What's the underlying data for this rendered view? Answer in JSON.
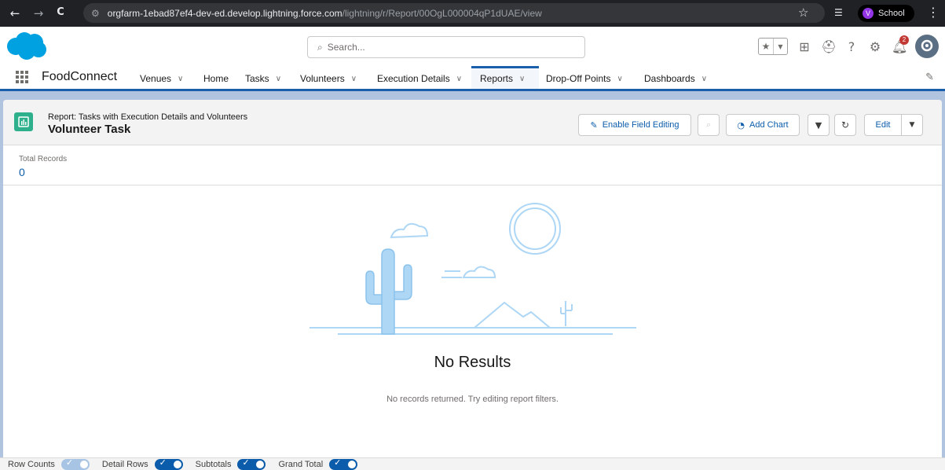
{
  "browser": {
    "back": "←",
    "forward": "→",
    "reload": "C",
    "url_host": "orgfarm-1ebad87ef4-dev-ed.develop.lightning.force.com",
    "url_path": "/lightning/r/Report/00OgL000004qP1dUAE/view",
    "profile_initial": "V",
    "profile_name": "School",
    "menu": "⋮"
  },
  "header": {
    "search_placeholder": "Search...",
    "notification_count": "2"
  },
  "nav": {
    "app_name": "FoodConnect",
    "items": [
      {
        "label": "Venues",
        "has_menu": true
      },
      {
        "label": "Home",
        "has_menu": false
      },
      {
        "label": "Tasks",
        "has_menu": true
      },
      {
        "label": "Volunteers",
        "has_menu": true
      },
      {
        "label": "Execution Details",
        "has_menu": true
      },
      {
        "label": "Reports",
        "has_menu": true,
        "active": true
      },
      {
        "label": "Drop-Off Points",
        "has_menu": true
      },
      {
        "label": "Dashboards",
        "has_menu": true
      }
    ]
  },
  "report": {
    "kicker": "Report: Tasks with Execution Details and Volunteers",
    "title": "Volunteer Task",
    "buttons": {
      "enable_field_editing": "Enable Field Editing",
      "add_chart": "Add Chart",
      "edit": "Edit"
    },
    "total_records_label": "Total Records",
    "total_records_value": "0",
    "empty_title": "No Results",
    "empty_message": "No records returned. Try editing report filters."
  },
  "footer": {
    "toggles": [
      {
        "label": "Row Counts",
        "on": false
      },
      {
        "label": "Detail Rows",
        "on": true
      },
      {
        "label": "Subtotals",
        "on": true
      },
      {
        "label": "Grand Total",
        "on": true
      }
    ]
  },
  "colors": {
    "brand_blue": "#0b5cab",
    "nav_accent": "#1b5faa",
    "report_icon": "#2eb08c",
    "illustration": "#aed6f5"
  }
}
